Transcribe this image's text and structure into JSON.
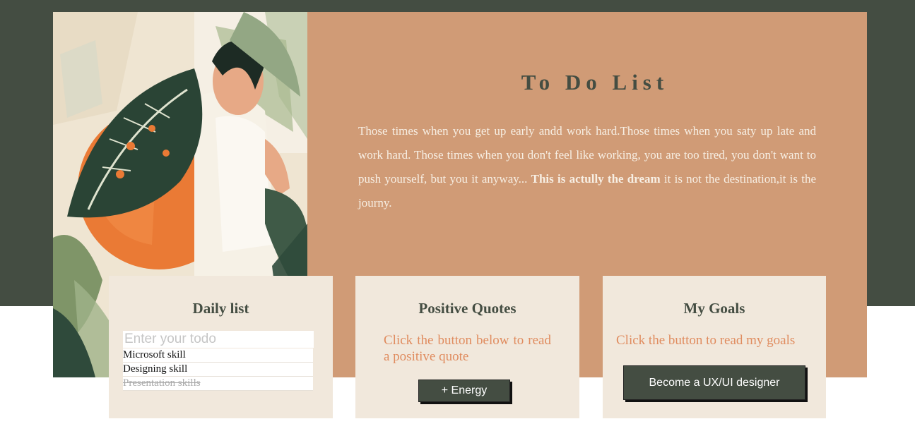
{
  "hero": {
    "title": "To Do List",
    "text_before": "Those times when you get up early andd work hard.Those times when you saty up late and work hard. Those times when you don't feel like working, you are too tired, you don't want to push yourself, but you it anyway... ",
    "text_bold": "This is actully the dream",
    "text_after": " it is not the destination,it is the journy."
  },
  "daily": {
    "title": "Daily list",
    "input_placeholder": "Enter your todo",
    "items": [
      {
        "label": "Microsoft skill",
        "done": false
      },
      {
        "label": "Designing skill",
        "done": false
      },
      {
        "label": "Presentation skills",
        "done": true
      }
    ]
  },
  "quotes": {
    "title": "Positive Quotes",
    "text": "Click the button below to read a positive quote",
    "button_label": "+ Energy"
  },
  "goals": {
    "title": "My Goals",
    "text": "Click the button to read my goals",
    "button_label": "Become a UX/UI designer"
  },
  "colors": {
    "dark_green": "#444d42",
    "terracotta": "#d09b76",
    "card_bg": "#f1e8dc",
    "accent_text": "#e08c5f"
  }
}
